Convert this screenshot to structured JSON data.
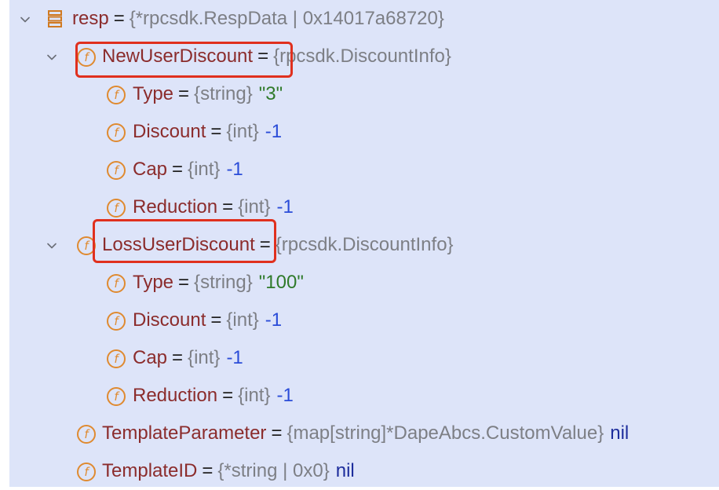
{
  "tree": {
    "root": {
      "name": "resp",
      "eq": "=",
      "type": "{*rpcsdk.RespData | 0x14017a68720}",
      "icon": "struct-icon"
    },
    "new_user": {
      "name": "NewUserDiscount",
      "eq": "=",
      "type": "{rpcsdk.DiscountInfo}",
      "fields": [
        {
          "name": "Type",
          "eq": "=",
          "type": "{string}",
          "value": "\"3\"",
          "kind": "string"
        },
        {
          "name": "Discount",
          "eq": "=",
          "type": "{int}",
          "value": "-1",
          "kind": "number"
        },
        {
          "name": "Cap",
          "eq": "=",
          "type": "{int}",
          "value": "-1",
          "kind": "number"
        },
        {
          "name": "Reduction",
          "eq": "=",
          "type": "{int}",
          "value": "-1",
          "kind": "number"
        }
      ]
    },
    "loss_user": {
      "name": "LossUserDiscount",
      "eq": "=",
      "type": "{rpcsdk.DiscountInfo}",
      "fields": [
        {
          "name": "Type",
          "eq": "=",
          "type": "{string}",
          "value": "\"100\"",
          "kind": "string"
        },
        {
          "name": "Discount",
          "eq": "=",
          "type": "{int}",
          "value": "-1",
          "kind": "number"
        },
        {
          "name": "Cap",
          "eq": "=",
          "type": "{int}",
          "value": "-1",
          "kind": "number"
        },
        {
          "name": "Reduction",
          "eq": "=",
          "type": "{int}",
          "value": "-1",
          "kind": "number"
        }
      ]
    },
    "template_parameter": {
      "name": "TemplateParameter",
      "eq": "=",
      "type": "{map[string]*DapeAbcs.CustomValue}",
      "value": "nil"
    },
    "template_id": {
      "name": "TemplateID",
      "eq": "=",
      "type": "{*string | 0x0}",
      "value": "nil"
    },
    "field_icon_glyph": "f"
  },
  "colors": {
    "panel_bg": "#dde4f9",
    "field_name": "#8b2c2c",
    "type_gray": "#7d7f85",
    "number_blue": "#2a4cd8",
    "string_green": "#2f7a2a",
    "nil_blue": "#1d2d9c",
    "field_icon_orange": "#df8a30",
    "highlight_red": "#e0301e"
  }
}
